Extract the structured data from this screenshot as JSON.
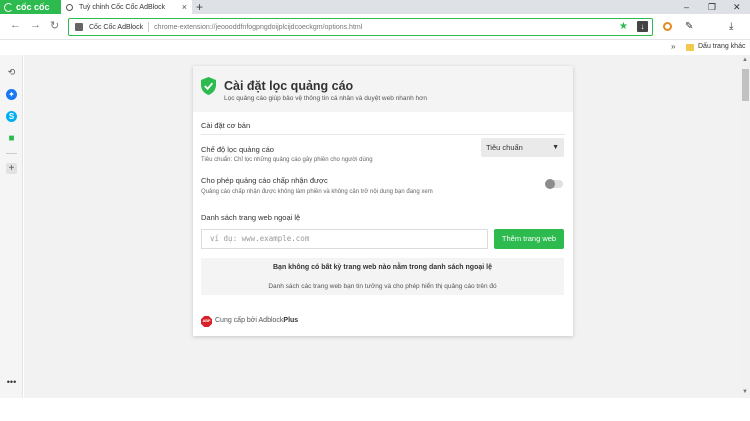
{
  "browser": {
    "brand": "cốc cốc",
    "tab_title": "Tuỳ chỉnh Cốc Cốc AdBlock",
    "tab_close": "×",
    "new_tab": "+",
    "win_min": "–",
    "win_max": "❐",
    "win_close": "✕",
    "back": "←",
    "forward": "→",
    "reload": "↻",
    "omnibox_label": "Cốc Cốc AdBlock",
    "omnibox_url": "chrome-extension://jeoooddfnfogpngdoijplcijdcoeckgm/options.html",
    "bookmarks_more": "»",
    "bookmarks_folder": "Dấu trang khác",
    "accent_color": "#2dbb4f"
  },
  "options": {
    "title": "Cài đặt lọc quảng cáo",
    "subtitle": "Lọc quảng cáo giúp bảo vệ thông tin cá nhân và duyệt web nhanh hơn",
    "section_title": "Cài đặt cơ bản",
    "filter_level": {
      "title": "Chế độ lọc quảng cáo",
      "desc": "Tiêu chuẩn: Chỉ lọc những quảng cáo gây phiền cho người dùng",
      "selected": "Tiêu chuẩn",
      "caret": "▼"
    },
    "acceptable_ads": {
      "title": "Cho phép quảng cáo chấp nhận được",
      "desc": "Quảng cáo chấp nhận được không làm phiền và không cản trở nội dung bạn đang xem",
      "enabled": false
    },
    "whitelist": {
      "title": "Danh sách trang web ngoại lệ",
      "placeholder": "ví dụ: www.example.com",
      "add_button": "Thêm trang web",
      "empty_title": "Bạn không có bất kỳ trang web nào nằm trong danh sách ngoại lệ",
      "empty_desc": "Danh sách các trang web bạn tin tưởng và cho phép hiển thị quảng cáo trên đó"
    },
    "footer": {
      "logo": "ABP",
      "prefix": "Cung cấp bởi Adblock",
      "brand": "Plus"
    }
  }
}
